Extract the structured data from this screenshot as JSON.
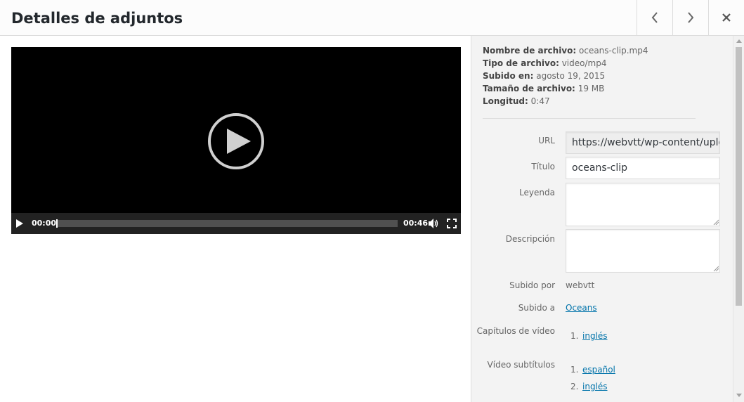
{
  "header": {
    "title": "Detalles de adjuntos",
    "prev_icon": "chevron-left-icon",
    "next_icon": "chevron-right-icon",
    "close_icon": "close-icon"
  },
  "player": {
    "current_time": "00:00",
    "duration": "00:46",
    "progress": 0
  },
  "file_details": {
    "filename_label": "Nombre de archivo:",
    "filename": "oceans-clip.mp4",
    "filetype_label": "Tipo de archivo:",
    "filetype": "video/mp4",
    "uploaded_label": "Subido en:",
    "uploaded": "agosto 19, 2015",
    "size_label": "Tamaño de archivo:",
    "size": "19 MB",
    "length_label": "Longitud:",
    "length": "0:47"
  },
  "form": {
    "url_label": "URL",
    "url_value": "https://webvtt/wp-content/uploads",
    "title_label": "Título",
    "title_value": "oceans-clip",
    "caption_label": "Leyenda",
    "caption_value": "",
    "description_label": "Descripción",
    "description_value": "",
    "uploaded_by_label": "Subido por",
    "uploaded_by_value": "webvtt",
    "uploaded_to_label": "Subido a",
    "uploaded_to_value": "Oceans",
    "chapters_label": "Capítulos de vídeo",
    "chapters": [
      {
        "num": "1.",
        "label": "inglés"
      }
    ],
    "subtitles_label": "Vídeo subtítulos",
    "subtitles": [
      {
        "num": "1.",
        "label": "español"
      },
      {
        "num": "2.",
        "label": "inglés"
      }
    ]
  },
  "colors": {
    "accent_link": "#0073aa",
    "video_bg": "#000000",
    "sidebar_bg": "#f3f3f3"
  }
}
